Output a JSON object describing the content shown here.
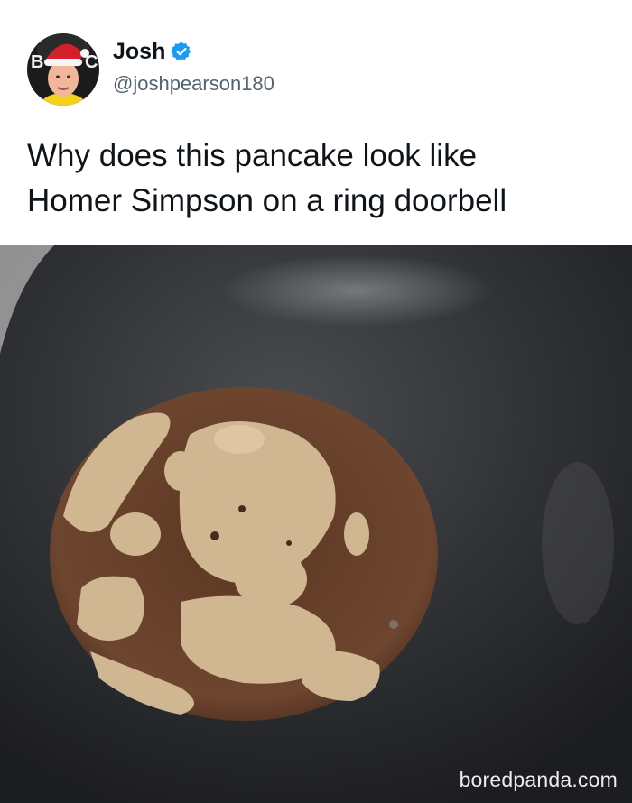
{
  "tweet": {
    "author_name": "Josh",
    "author_handle": "@joshpearson180",
    "verified_icon": "verified-badge-icon",
    "text_lines": [
      "Why does this pancake look like",
      "Homer Simpson on a ring doorbell"
    ]
  },
  "photo": {
    "subject": "pancake-in-frying-pan"
  },
  "watermark": {
    "text": "boredpanda.com"
  },
  "colors": {
    "verified_blue": "#1d9bf0",
    "name_text": "#0f1419",
    "handle_text": "#536471",
    "pan_dark": "#2b2d30",
    "pancake_brown": "#6b4328",
    "pancake_light": "#d7bf98"
  }
}
